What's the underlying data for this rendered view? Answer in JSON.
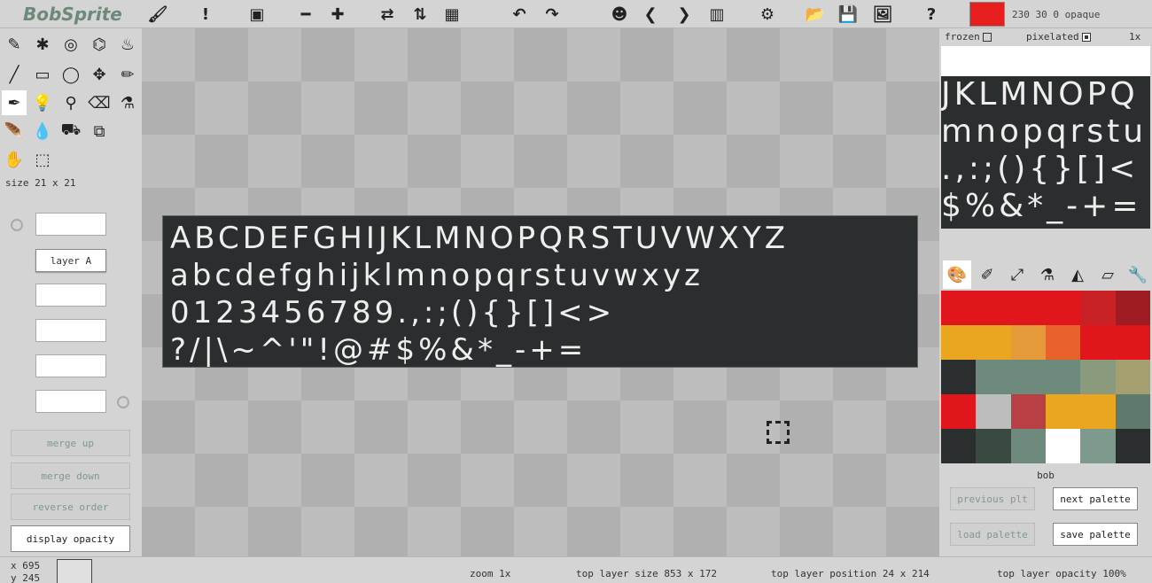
{
  "app": {
    "title": "BobSprite"
  },
  "topbar": {
    "icons": [
      {
        "name": "brush-icon",
        "glyph": "🖌"
      },
      {
        "name": "alert-icon",
        "glyph": "!"
      },
      {
        "name": "frame-icon",
        "glyph": "▣"
      },
      {
        "name": "minus-icon",
        "glyph": "━"
      },
      {
        "name": "plus-icon",
        "glyph": "✚"
      },
      {
        "name": "swap-icon",
        "glyph": "⇄"
      },
      {
        "name": "flip-icon",
        "glyph": "⇅"
      },
      {
        "name": "checker-icon",
        "glyph": "▦"
      },
      {
        "name": "undo-icon",
        "glyph": "↶"
      },
      {
        "name": "redo-icon",
        "glyph": "↷"
      },
      {
        "name": "head-icon",
        "glyph": "☻"
      },
      {
        "name": "chevron-left-icon",
        "glyph": "❮"
      },
      {
        "name": "chevron-right-icon",
        "glyph": "❯"
      },
      {
        "name": "columns-icon",
        "glyph": "▥"
      },
      {
        "name": "gear-icon",
        "glyph": "⚙"
      },
      {
        "name": "folder-icon",
        "glyph": "📂"
      },
      {
        "name": "save-icon",
        "glyph": "💾"
      },
      {
        "name": "image-save-icon",
        "glyph": "🖼"
      },
      {
        "name": "help-icon",
        "glyph": "?"
      }
    ],
    "color_value": "230 30 0 opaque",
    "color_hex": "#e61e1e"
  },
  "tools": [
    {
      "name": "scribble-icon",
      "glyph": "✎"
    },
    {
      "name": "spray-icon",
      "glyph": "✱"
    },
    {
      "name": "target-icon",
      "glyph": "◎"
    },
    {
      "name": "bucket-target-icon",
      "glyph": "⌬"
    },
    {
      "name": "fill-bucket-icon",
      "glyph": "♨"
    },
    {
      "name": "brush-tool-icon",
      "glyph": "╱"
    },
    {
      "name": "rectangle-icon",
      "glyph": "▭"
    },
    {
      "name": "ellipse-icon",
      "glyph": "◯"
    },
    {
      "name": "move-icon",
      "glyph": "✥"
    },
    {
      "name": "pencil-icon",
      "glyph": "✏"
    },
    {
      "name": "pen-icon",
      "glyph": "✒"
    },
    {
      "name": "bulb-dark-icon",
      "glyph": "💡"
    },
    {
      "name": "bulb-light-icon",
      "glyph": "⚲"
    },
    {
      "name": "eraser-icon",
      "glyph": "⌫"
    },
    {
      "name": "eyedropper-icon",
      "glyph": "⚗"
    },
    {
      "name": "feather-icon",
      "glyph": "🪶"
    },
    {
      "name": "drop-icon",
      "glyph": "💧"
    },
    {
      "name": "bucket-icon",
      "glyph": "⛟"
    },
    {
      "name": "scale-icon",
      "glyph": "⧉"
    },
    {
      "name": "hand-icon",
      "glyph": "✋"
    },
    {
      "name": "select-rect-icon",
      "glyph": "⬚"
    },
    {
      "name": "select-ellipse-icon",
      "glyph": "⬭"
    }
  ],
  "size_label": "size  21 x 21",
  "layers": [
    "",
    "layer A",
    "",
    "",
    "",
    ""
  ],
  "layer_buttons": [
    "merge up",
    "merge down",
    "reverse order",
    "display opacity"
  ],
  "sprite_lines": [
    "ABCDEFGHIJKLMNOPQRSTUVWXYZ",
    "abcdefghijklmnopqrstuvwxyz",
    "0123456789.,:;(){}[]<>",
    "?/|\\~^'\"!@#$%&*_-+="
  ],
  "preview": {
    "frozen_label": "frozen",
    "pixelated_label": "pixelated",
    "zoom_label": "1x",
    "lines": [
      "JKLMNOPQ",
      "mnopqrstu",
      ".,:;(){}[]<",
      "$%&*_-+="
    ]
  },
  "palette_tabs": [
    {
      "name": "palette-icon",
      "glyph": "🎨"
    },
    {
      "name": "palette-edit-icon",
      "glyph": "✐"
    },
    {
      "name": "expand-icon",
      "glyph": "⤢"
    },
    {
      "name": "dropper-icon",
      "glyph": "⚗"
    },
    {
      "name": "mirror-icon",
      "glyph": "◭"
    },
    {
      "name": "parallelogram-icon",
      "glyph": "▱"
    },
    {
      "name": "wrench-icon",
      "glyph": "🔧"
    }
  ],
  "palette_colors": [
    "#e0161c",
    "#e0161c",
    "#e0161c",
    "#e0161c",
    "#c92226",
    "#9e1c22",
    "#eba620",
    "#eba620",
    "#e59a3a",
    "#e8622c",
    "#e0161c",
    "#e0161c",
    "#2a2e2e",
    "#6e8a7c",
    "#6e8a7c",
    "#6e8a7c",
    "#8a9a7c",
    "#a6a070",
    "#e0161c",
    "#bdbdbd",
    "#b84044",
    "#eba620",
    "#eba620",
    "#5e7a6c",
    "#2a2e2e",
    "#3a4a40",
    "#6e8a7c",
    "#ffffff",
    "#7e9a8c",
    "#2a2e2e"
  ],
  "palette_name": "bob",
  "palette_buttons": {
    "previous": "previous plt",
    "next": "next palette",
    "load": "load palette",
    "save": "save palette"
  },
  "status": {
    "x": "x  695",
    "y": "y  245",
    "zoom": "zoom  1x",
    "top_layer_size": "top layer size  853 x 172",
    "top_layer_position": "top layer position  24 x 214",
    "top_layer_opacity": "top layer opacity  100%"
  }
}
